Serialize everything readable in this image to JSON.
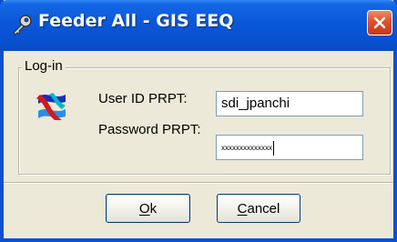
{
  "window": {
    "title": "Feeder All - GIS EEQ",
    "title_icon": "key-icon",
    "close_icon": "close-icon"
  },
  "login_group": {
    "legend": "Log-in",
    "logo": "app-logo-icon",
    "user_label": "User ID PRPT:",
    "user_value": "sdi_jpanchi",
    "password_label": "Password PRPT:",
    "password_value": "xxxxxxxxxxxxxx"
  },
  "buttons": {
    "ok_mnemonic": "O",
    "ok_rest": "k",
    "cancel_mnemonic": "C",
    "cancel_rest": "ancel"
  },
  "colors": {
    "titlebar": "#0a58d8",
    "dialog_bg": "#ece9d8",
    "close_button": "#e0502a",
    "field_border": "#7f9db9"
  }
}
